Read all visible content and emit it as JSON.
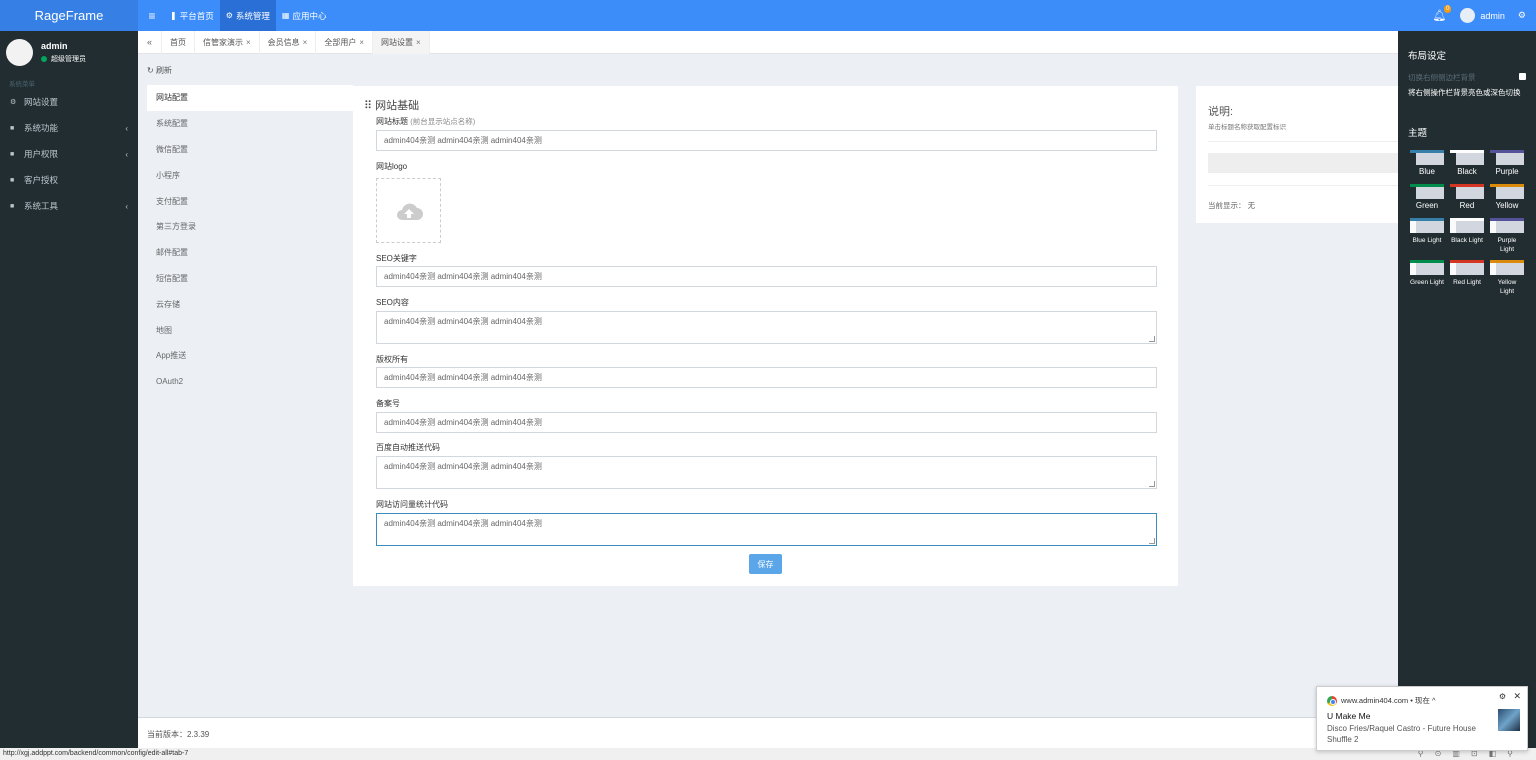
{
  "header": {
    "logo": "RageFrame",
    "nav": [
      {
        "label": "平台首页",
        "icon": "bookmark-icon",
        "glyph": "❚",
        "active": false
      },
      {
        "label": "系统管理",
        "icon": "cogs-icon",
        "glyph": "⚙",
        "active": true
      },
      {
        "label": "应用中心",
        "icon": "grid-icon",
        "glyph": "▦",
        "active": false
      }
    ],
    "notification_count": "0",
    "user": "admin"
  },
  "sidebar": {
    "user_name": "admin",
    "user_role": "超级管理员",
    "section_header": "系统菜单",
    "items": [
      {
        "label": "网站设置",
        "icon": "gear-icon",
        "glyph": "⚙",
        "has_children": false
      },
      {
        "label": "系统功能",
        "icon": "briefcase-icon",
        "glyph": "■",
        "has_children": true
      },
      {
        "label": "用户权限",
        "icon": "user-lock-icon",
        "glyph": "■",
        "has_children": true
      },
      {
        "label": "客户授权",
        "icon": "square-icon",
        "glyph": "■",
        "has_children": false
      },
      {
        "label": "系统工具",
        "icon": "tool-icon",
        "glyph": "■",
        "has_children": true
      }
    ]
  },
  "tabs": {
    "back": "«",
    "items": [
      {
        "label": "首页",
        "closable": false,
        "active": false
      },
      {
        "label": "信管家演示",
        "closable": true,
        "active": false
      },
      {
        "label": "会员信息",
        "closable": true,
        "active": false
      },
      {
        "label": "全部用户",
        "closable": true,
        "active": false
      },
      {
        "label": "网站设置",
        "closable": true,
        "active": true
      }
    ]
  },
  "refresh_label": "刷新",
  "config_nav": [
    {
      "label": "网站配置",
      "active": true
    },
    {
      "label": "系统配置",
      "active": false
    },
    {
      "label": "微信配置",
      "active": false
    },
    {
      "label": "小程序",
      "active": false
    },
    {
      "label": "支付配置",
      "active": false
    },
    {
      "label": "第三方登录",
      "active": false
    },
    {
      "label": "邮件配置",
      "active": false
    },
    {
      "label": "短信配置",
      "active": false
    },
    {
      "label": "云存储",
      "active": false
    },
    {
      "label": "地图",
      "active": false
    },
    {
      "label": "App推送",
      "active": false
    },
    {
      "label": "OAuth2",
      "active": false
    }
  ],
  "form": {
    "title": "网站基础",
    "site_title_label": "网站标题",
    "site_title_hint": "(前台显示站点名称)",
    "site_title_value": "admin404亲测 admin404亲测 admin404亲测",
    "logo_label": "网站logo",
    "seo_keywords_label": "SEO关键字",
    "seo_keywords_value": "admin404亲测 admin404亲测 admin404亲测",
    "seo_content_label": "SEO内容",
    "seo_content_value": "admin404亲测 admin404亲测 admin404亲测",
    "copyright_label": "版权所有",
    "copyright_value": "admin404亲测 admin404亲测 admin404亲测",
    "icp_label": "备案号",
    "icp_value": "admin404亲测 admin404亲测 admin404亲测",
    "baidu_push_label": "百度自动推送代码",
    "baidu_push_value": "admin404亲测 admin404亲测 admin404亲测",
    "stats_label": "网站访问量统计代码",
    "stats_value": "admin404亲测 admin404亲测 admin404亲测",
    "save_label": "保存"
  },
  "description": {
    "title": "说明:",
    "subtitle": "单击标题名称获取配置标识",
    "current": "当前显示： 无"
  },
  "control_sidebar": {
    "layout_title": "布局设定",
    "option_label": "切换右侧侧边栏背景",
    "option_desc": "将右侧操作栏背景亮色或深色切换",
    "theme_title": "主题",
    "themes": [
      {
        "label": "Blue",
        "bar": "#367fa9",
        "side": "#222d32"
      },
      {
        "label": "Black",
        "bar": "#fefefe",
        "side": "#222d32"
      },
      {
        "label": "Purple",
        "bar": "#555299",
        "side": "#222d32"
      },
      {
        "label": "Green",
        "bar": "#008d4c",
        "side": "#222d32"
      },
      {
        "label": "Red",
        "bar": "#d33724",
        "side": "#222d32"
      },
      {
        "label": "Yellow",
        "bar": "#db8b0b",
        "side": "#222d32"
      },
      {
        "label": "Blue Light",
        "bar": "#367fa9",
        "side": "#f9fafc"
      },
      {
        "label": "Black Light",
        "bar": "#fefefe",
        "side": "#f9fafc"
      },
      {
        "label": "Purple Light",
        "bar": "#555299",
        "side": "#f9fafc"
      },
      {
        "label": "Green Light",
        "bar": "#008d4c",
        "side": "#f9fafc"
      },
      {
        "label": "Red Light",
        "bar": "#d33724",
        "side": "#f9fafc"
      },
      {
        "label": "Yellow Light",
        "bar": "#db8b0b",
        "side": "#f9fafc"
      }
    ]
  },
  "footer": {
    "version": "当前版本：2.3.39"
  },
  "status_url": "http://xgj.addppt.com/backend/common/config/edit-all#tab-7",
  "notification": {
    "source": "www.admin404.com • 现在 ^",
    "title": "U Make Me",
    "body": "Disco Fries/Raquel Castro - Future House Shuffle 2"
  }
}
